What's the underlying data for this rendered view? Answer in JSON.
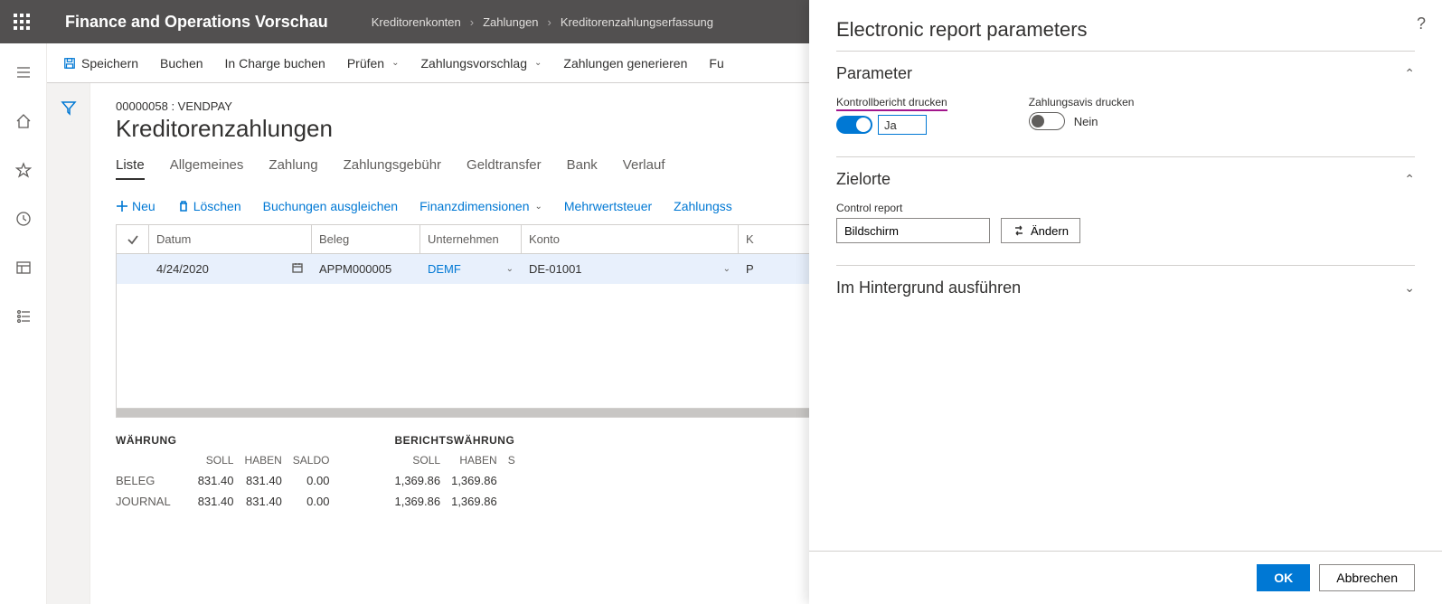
{
  "header": {
    "app_title": "Finance and Operations Vorschau",
    "breadcrumbs": [
      "Kreditorenkonten",
      "Zahlungen",
      "Kreditorenzahlungserfassung"
    ]
  },
  "action_bar": {
    "save": "Speichern",
    "post": "Buchen",
    "post_in_charge": "In Charge buchen",
    "validate": "Prüfen",
    "payment_proposal": "Zahlungsvorschlag",
    "generate_payments": "Zahlungen generieren",
    "more": "Fu"
  },
  "page": {
    "journal_id": "00000058 : VENDPAY",
    "title": "Kreditorenzahlungen",
    "tabs": [
      "Liste",
      "Allgemeines",
      "Zahlung",
      "Zahlungsgebühr",
      "Geldtransfer",
      "Bank",
      "Verlauf"
    ],
    "active_tab": "Liste"
  },
  "sub_actions": {
    "new": "Neu",
    "delete": "Löschen",
    "settle": "Buchungen ausgleichen",
    "fin_dim": "Finanzdimensionen",
    "vat": "Mehrwertsteuer",
    "payment_status": "Zahlungss"
  },
  "grid": {
    "headers": {
      "date": "Datum",
      "voucher": "Beleg",
      "company": "Unternehmen",
      "account": "Konto",
      "vendor_name": "K"
    },
    "row": {
      "date": "4/24/2020",
      "voucher": "APPM000005",
      "company": "DEMF",
      "account": "DE-01001",
      "vendor_name_partial": "P"
    }
  },
  "summary": {
    "currency_title": "WÄHRUNG",
    "reporting_title": "BERICHTSWÄHRUNG",
    "cols": {
      "debit": "SOLL",
      "credit": "HABEN",
      "balance": "SALDO",
      "extra": "S"
    },
    "rows": {
      "voucher": "BELEG",
      "journal": "JOURNAL"
    },
    "currency": {
      "voucher": {
        "debit": "831.40",
        "credit": "831.40",
        "balance": "0.00"
      },
      "journal": {
        "debit": "831.40",
        "credit": "831.40",
        "balance": "0.00"
      }
    },
    "reporting": {
      "voucher": {
        "debit": "1,369.86",
        "credit": "1,369.86"
      },
      "journal": {
        "debit": "1,369.86",
        "credit": "1,369.86"
      }
    }
  },
  "panel": {
    "title": "Electronic report parameters",
    "sections": {
      "parameter": {
        "title": "Parameter",
        "print_control_label": "Kontrollbericht drucken",
        "print_control_value": "Ja",
        "print_control_on": true,
        "print_advice_label": "Zahlungsavis drucken",
        "print_advice_value": "Nein",
        "print_advice_on": false
      },
      "destinations": {
        "title": "Zielorte",
        "control_report_label": "Control report",
        "control_report_value": "Bildschirm",
        "change_btn": "Ändern"
      },
      "background": {
        "title": "Im Hintergrund ausführen"
      }
    },
    "footer": {
      "ok": "OK",
      "cancel": "Abbrechen"
    }
  }
}
